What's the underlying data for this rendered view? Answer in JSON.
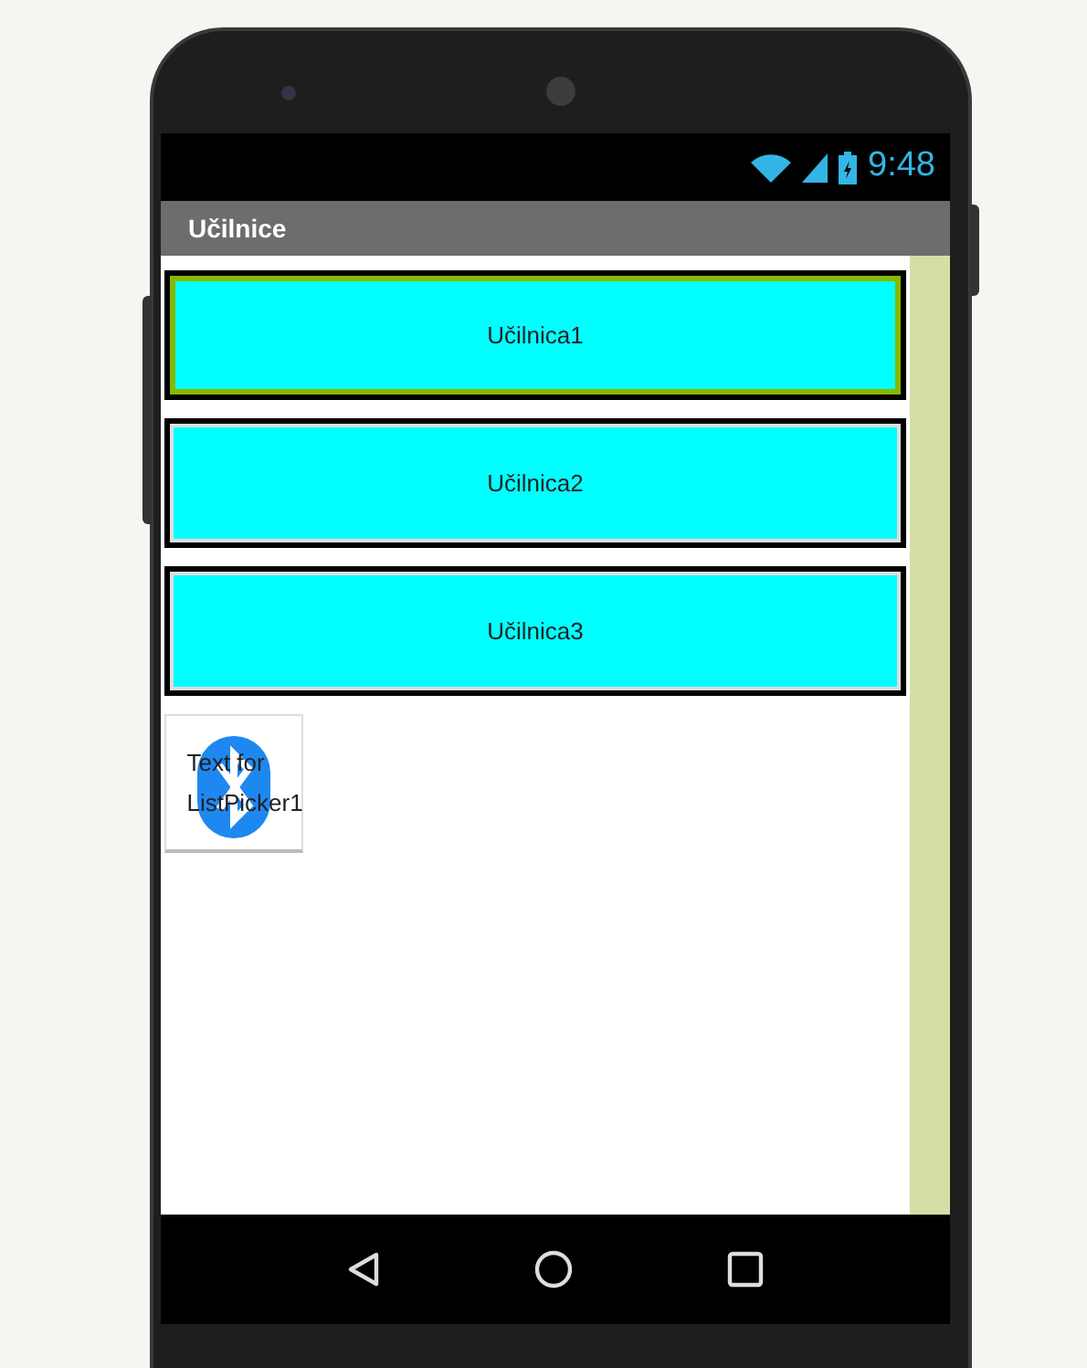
{
  "status_bar": {
    "time": "9:48"
  },
  "title_bar": {
    "title": "Učilnice"
  },
  "buttons": [
    {
      "label": "Učilnica1",
      "selected": true
    },
    {
      "label": "Učilnica2",
      "selected": false
    },
    {
      "label": "Učilnica3",
      "selected": false
    }
  ],
  "list_picker": {
    "label": "Text for ListPicker1"
  }
}
